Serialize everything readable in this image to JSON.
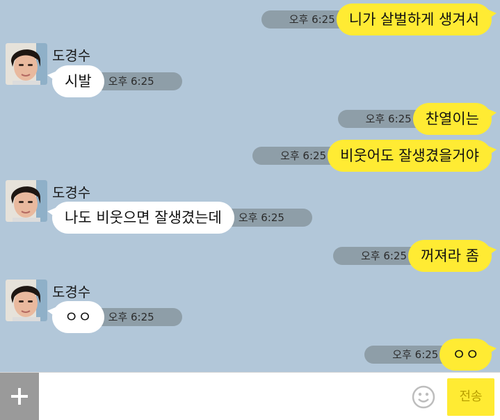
{
  "colors": {
    "background": "#b2c7d9",
    "my_bubble": "#ffeb33",
    "their_bubble": "#ffffff",
    "time_pill": "#8e9ea8",
    "send_button": "#ffeb33"
  },
  "messages": [
    {
      "direction": "out",
      "text": "니가 살벌하게 생겨서",
      "time": "오후 6:25"
    },
    {
      "direction": "in",
      "sender": "도경수",
      "text": "시발",
      "time": "오후 6:25"
    },
    {
      "direction": "out",
      "text": "찬열이는",
      "time": "오후 6:25"
    },
    {
      "direction": "out",
      "text": "비웃어도 잘생겼을거야",
      "time": "오후 6:25"
    },
    {
      "direction": "in",
      "sender": "도경수",
      "text": "나도 비웃으면 잘생겼는데",
      "time": "오후 6:25"
    },
    {
      "direction": "out",
      "text": "꺼져라 좀",
      "time": "오후 6:25"
    },
    {
      "direction": "in",
      "sender": "도경수",
      "text": "ㅇㅇ",
      "time": "오후 6:25"
    },
    {
      "direction": "out",
      "text": "ㅇㅇ",
      "time": "오후 6:25"
    }
  ],
  "footer": {
    "plus_icon": "plus-icon",
    "input_value": "",
    "emoji_icon": "smiley-icon",
    "send_label": "전송"
  }
}
